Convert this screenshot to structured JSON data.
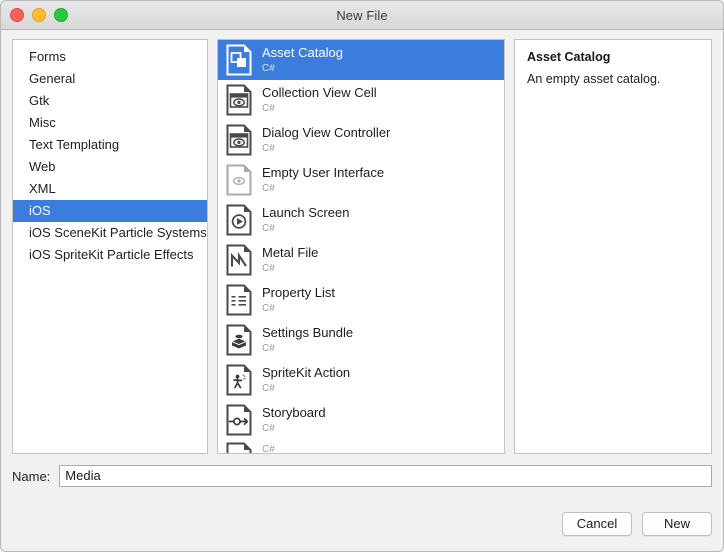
{
  "window": {
    "title": "New File",
    "traffic_lights": [
      {
        "name": "close-button",
        "color": "#ff6058"
      },
      {
        "name": "minimize-button",
        "color": "#ffbd2e"
      },
      {
        "name": "maximize-button",
        "color": "#28ca42"
      }
    ]
  },
  "colors": {
    "selection_blue": "#3b7ddd",
    "window_background": "#f1f1f1",
    "panel_background": "#ffffff"
  },
  "categories": {
    "items": [
      {
        "label": "Forms",
        "selected": false
      },
      {
        "label": "General",
        "selected": false
      },
      {
        "label": "Gtk",
        "selected": false
      },
      {
        "label": "Misc",
        "selected": false
      },
      {
        "label": "Text Templating",
        "selected": false
      },
      {
        "label": "Web",
        "selected": false
      },
      {
        "label": "XML",
        "selected": false
      },
      {
        "label": "iOS",
        "selected": true
      },
      {
        "label": "iOS SceneKit Particle Systems",
        "selected": false
      },
      {
        "label": "iOS SpriteKit Particle Effects",
        "selected": false
      }
    ]
  },
  "templates": {
    "items": [
      {
        "name": "Asset Catalog",
        "language": "C#",
        "icon": "asset-catalog-icon",
        "selected": true
      },
      {
        "name": "Collection View Cell",
        "language": "C#",
        "icon": "collection-view-cell-icon",
        "selected": false
      },
      {
        "name": "Dialog View Controller",
        "language": "C#",
        "icon": "dialog-view-controller-icon",
        "selected": false
      },
      {
        "name": "Empty User Interface",
        "language": "C#",
        "icon": "empty-user-interface-icon",
        "selected": false
      },
      {
        "name": "Launch Screen",
        "language": "C#",
        "icon": "launch-screen-icon",
        "selected": false
      },
      {
        "name": "Metal File",
        "language": "C#",
        "icon": "metal-file-icon",
        "selected": false
      },
      {
        "name": "Property List",
        "language": "C#",
        "icon": "property-list-icon",
        "selected": false
      },
      {
        "name": "Settings Bundle",
        "language": "C#",
        "icon": "settings-bundle-icon",
        "selected": false
      },
      {
        "name": "SpriteKit Action",
        "language": "C#",
        "icon": "spritekit-action-icon",
        "selected": false
      },
      {
        "name": "Storyboard",
        "language": "C#",
        "icon": "storyboard-icon",
        "selected": false
      },
      {
        "name": "",
        "language": "C#",
        "icon": "document-icon",
        "selected": false
      }
    ]
  },
  "detail": {
    "title": "Asset Catalog",
    "description": "An empty asset catalog."
  },
  "bottom": {
    "name_label": "Name:",
    "name_value": "Media",
    "name_placeholder": "",
    "cancel_label": "Cancel",
    "new_label": "New"
  }
}
